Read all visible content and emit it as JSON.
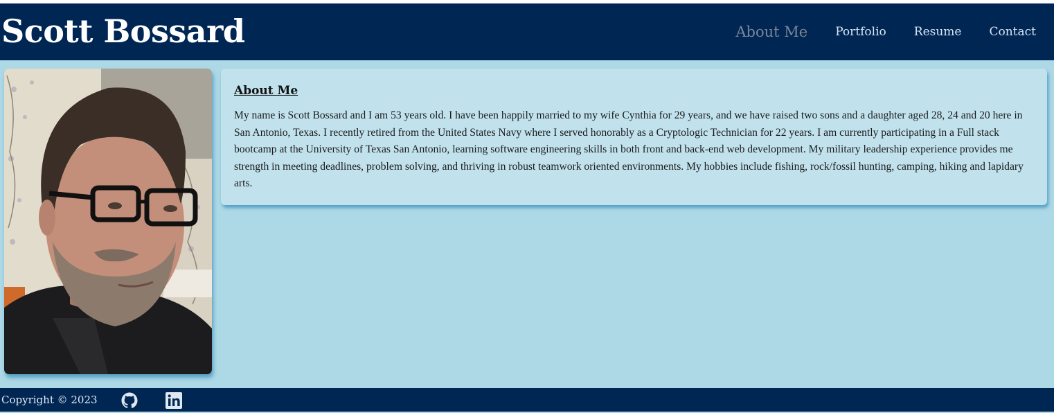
{
  "header": {
    "title": "Scott Bossard",
    "nav": [
      {
        "label": "About Me",
        "active": true
      },
      {
        "label": "Portfolio",
        "active": false
      },
      {
        "label": "Resume",
        "active": false
      },
      {
        "label": "Contact",
        "active": false
      }
    ]
  },
  "about": {
    "heading": "About Me",
    "body": "My name is Scott Bossard and I am 53 years old. I have been happily married to my wife Cynthia for 29 years, and we have raised two sons and a daughter aged 28, 24 and 20 here in San Antonio, Texas. I recently retired from the United States Navy where I served honorably as a Cryptologic Technician for 22 years. I am currently participating in a Full stack bootcamp at the University of Texas San Antonio, learning software engineering skills in both front and back-end web development. My military leadership experience provides me strength in meeting deadlines, problem solving, and thriving in robust teamwork oriented environments. My hobbies include fishing, rock/fossil hunting, camping, hiking and lapidary arts."
  },
  "footer": {
    "copyright": "Copyright © 2023",
    "icons": [
      "github-icon",
      "linkedin-icon"
    ]
  },
  "colors": {
    "header_bg": "#002654",
    "page_bg": "#add8e6",
    "card_bg": "#c1e2ed",
    "nav_active": "#7b8697"
  }
}
